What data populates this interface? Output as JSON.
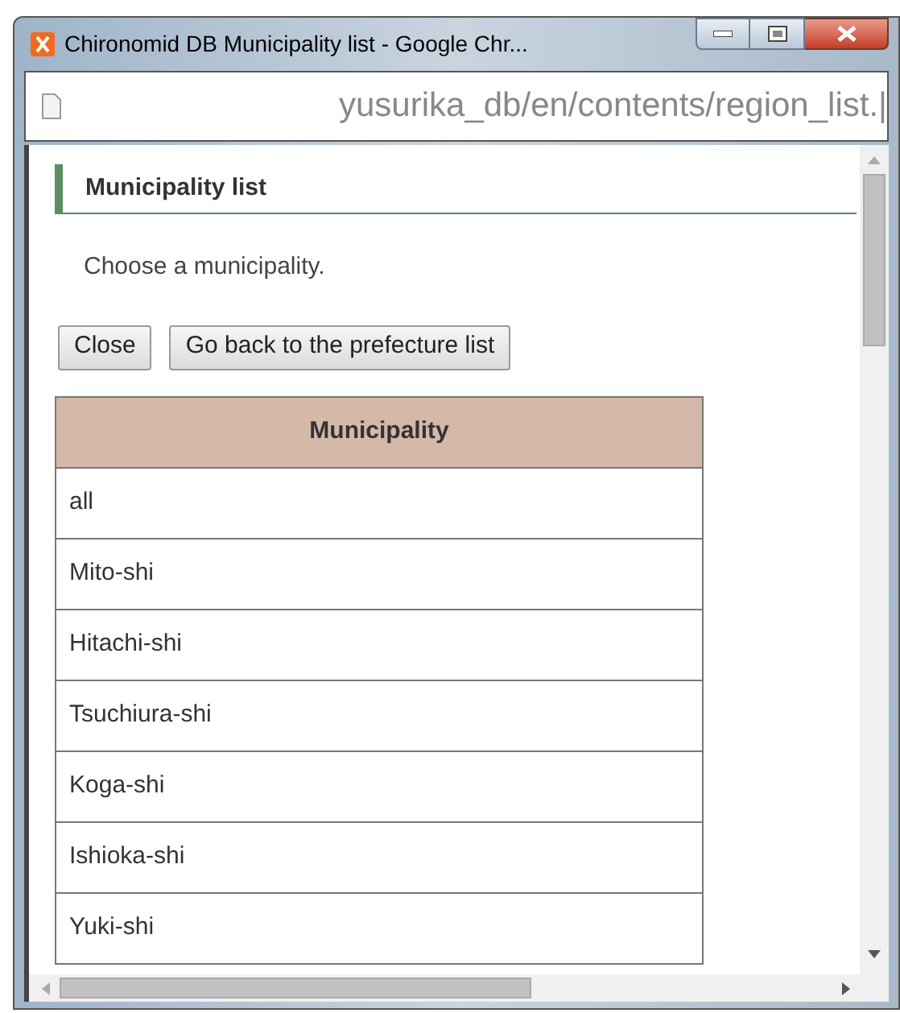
{
  "window": {
    "title": "Chironomid DB Municipality list - Google Chr..."
  },
  "address_bar": {
    "url": "yusurika_db/en/contents/region_list.|"
  },
  "heading": "Municipality list",
  "instruction": "Choose a municipality.",
  "buttons": [
    "Close",
    "Go back to the prefecture list"
  ],
  "table": {
    "columns": [
      "Municipality"
    ],
    "rows": [
      [
        "all"
      ],
      [
        "Mito-shi"
      ],
      [
        "Hitachi-shi"
      ],
      [
        "Tsuchiura-shi"
      ],
      [
        "Koga-shi"
      ],
      [
        "Ishioka-shi"
      ],
      [
        "Yuki-shi"
      ]
    ]
  }
}
